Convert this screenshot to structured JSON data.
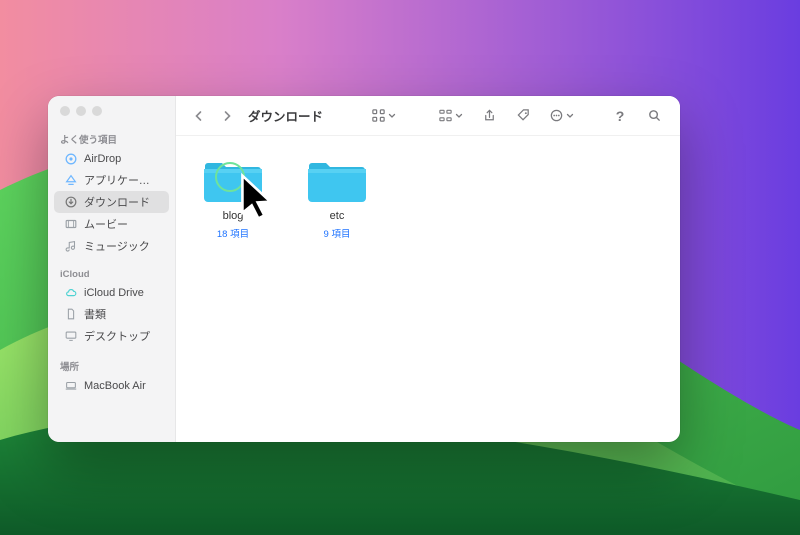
{
  "sidebar": {
    "sections": [
      {
        "header": "よく使う項目",
        "items": [
          {
            "label": "AirDrop",
            "icon": "airdrop",
            "selected": false
          },
          {
            "label": "アプリケーシ…",
            "icon": "applications",
            "selected": false
          },
          {
            "label": "ダウンロード",
            "icon": "downloads",
            "selected": true
          },
          {
            "label": "ムービー",
            "icon": "movies",
            "selected": false
          },
          {
            "label": "ミュージック",
            "icon": "music",
            "selected": false
          }
        ]
      },
      {
        "header": "iCloud",
        "items": [
          {
            "label": "iCloud Drive",
            "icon": "cloud",
            "selected": false
          },
          {
            "label": "書類",
            "icon": "documents",
            "selected": false
          },
          {
            "label": "デスクトップ",
            "icon": "desktop",
            "selected": false
          }
        ]
      },
      {
        "header": "場所",
        "items": [
          {
            "label": "MacBook Air",
            "icon": "laptop",
            "selected": false
          }
        ]
      }
    ]
  },
  "toolbar": {
    "title": "ダウンロード"
  },
  "folders": [
    {
      "name": "blog",
      "count": "18 項目",
      "highlighted": true
    },
    {
      "name": "etc",
      "count": "9 項目",
      "highlighted": false
    }
  ],
  "colors": {
    "folder": "#3fc6f0",
    "folder_tab": "#30b7e0",
    "accent": "#1e73ff",
    "highlight_ring": "#6fe39a"
  }
}
